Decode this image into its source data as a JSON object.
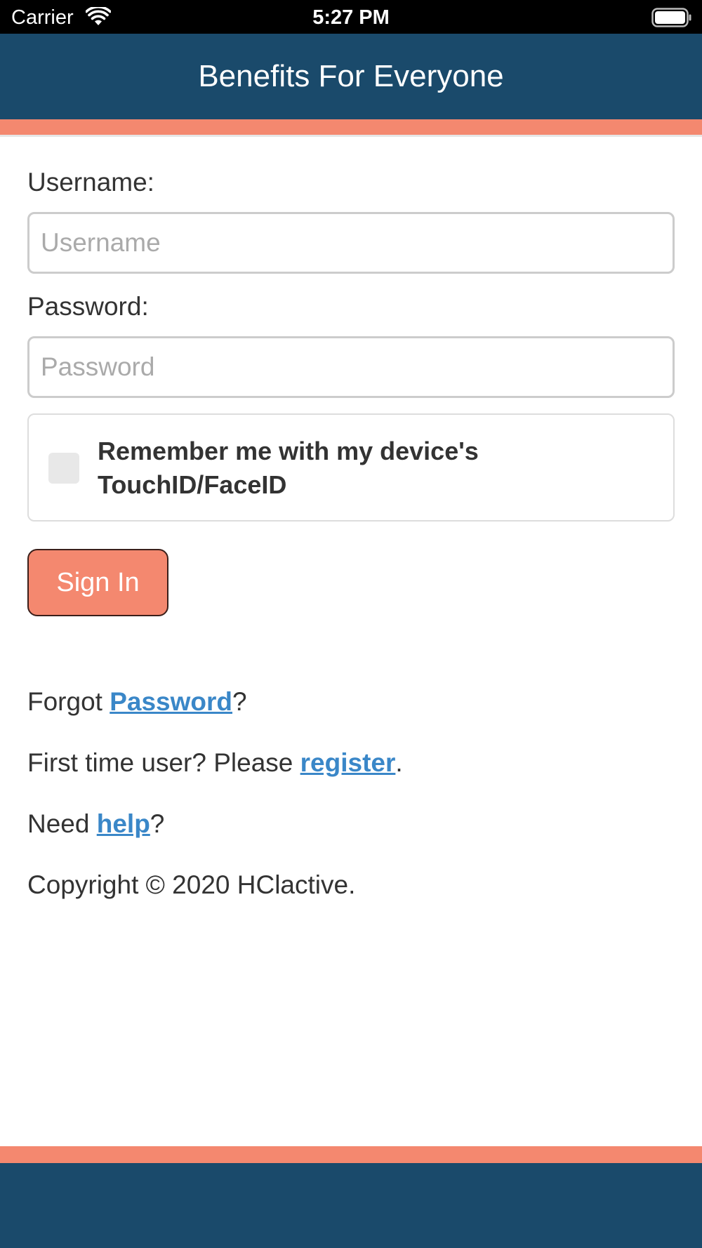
{
  "status_bar": {
    "carrier": "Carrier",
    "time": "5:27 PM",
    "wifi_icon": "wifi-icon",
    "battery_icon": "battery-full-icon"
  },
  "header": {
    "title": "Benefits For Everyone"
  },
  "form": {
    "username_label": "Username:",
    "username_placeholder": "Username",
    "username_value": "",
    "password_label": "Password:",
    "password_placeholder": "Password",
    "password_value": "",
    "remember_label": "Remember me with my device's TouchID/FaceID",
    "remember_checked": false,
    "signin_label": "Sign In"
  },
  "links": {
    "forgot_prefix": "Forgot ",
    "forgot_link": "Password",
    "forgot_suffix": "?",
    "register_prefix": "First time user? Please ",
    "register_link": "register",
    "register_suffix": ".",
    "help_prefix": "Need ",
    "help_link": "help",
    "help_suffix": "?"
  },
  "copyright": "Copyright © 2020 HClactive.",
  "colors": {
    "header_bg": "#1a4a6b",
    "accent": "#f4886f",
    "link": "#3a87c8",
    "text": "#333333"
  }
}
